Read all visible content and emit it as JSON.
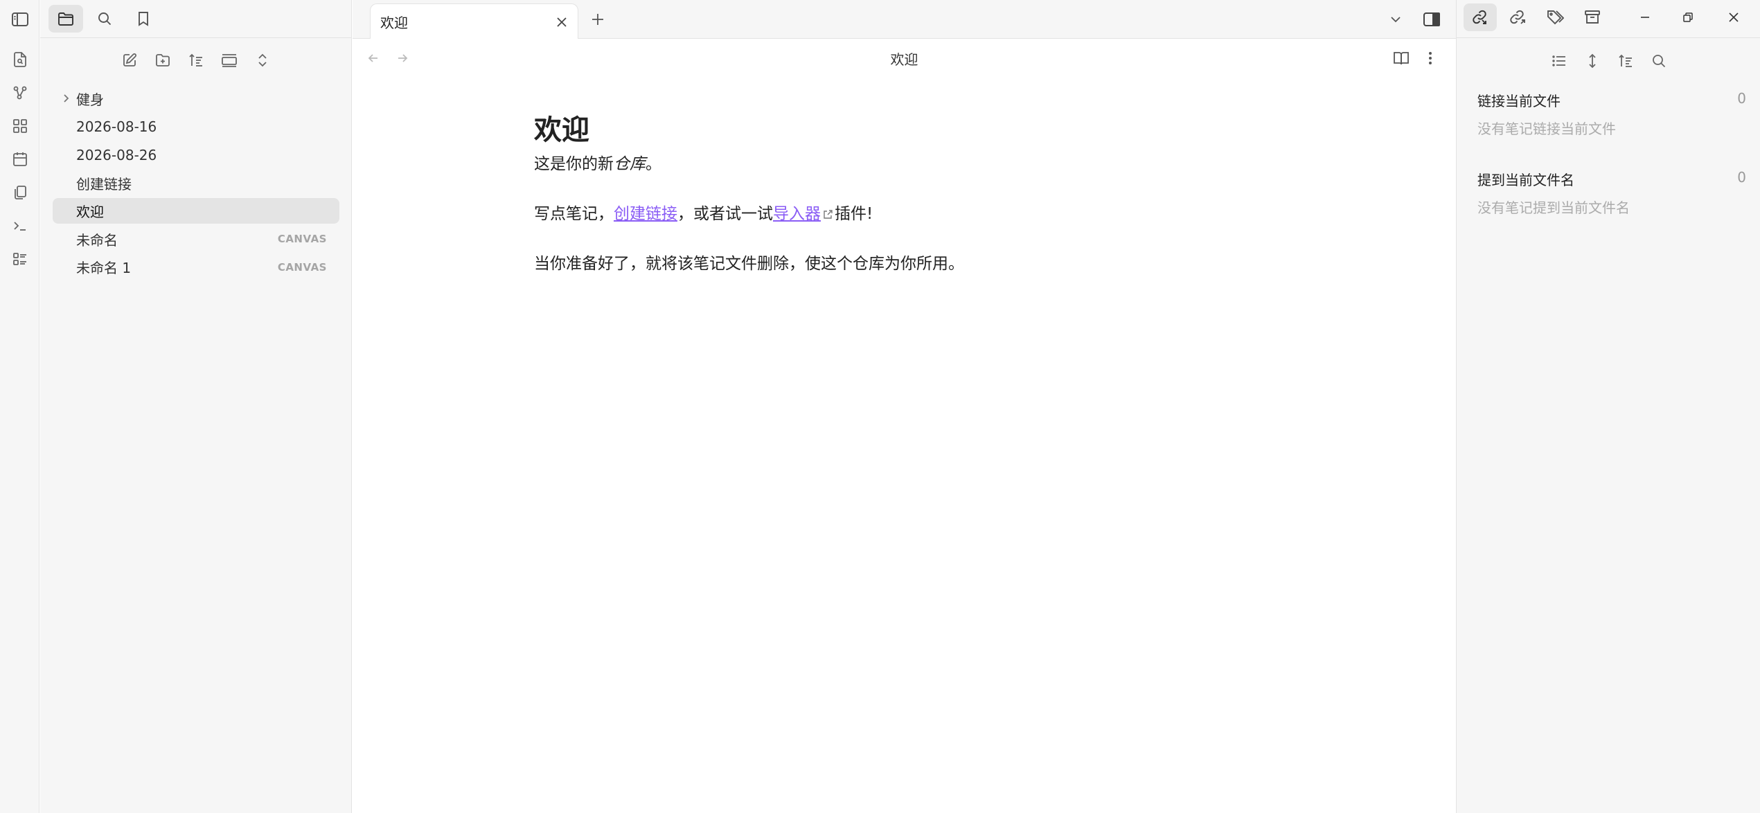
{
  "ribbon": {
    "top_icon": "sidebar-left-toggle-icon",
    "icons": [
      "quick-switcher-icon",
      "graph-view-icon",
      "canvas-icon",
      "daily-note-icon",
      "templates-icon",
      "command-palette-icon",
      "bases-icon"
    ]
  },
  "file_explorer": {
    "tabs": [
      "folder-icon",
      "search-icon",
      "bookmark-icon"
    ],
    "actions": [
      "new-note-icon",
      "new-folder-icon",
      "sort-icon",
      "collapse-all-icon",
      "expand-collapse-icon"
    ],
    "items": [
      {
        "label": "健身",
        "tag": "",
        "type": "folder"
      },
      {
        "label": "2026-08-16",
        "tag": "",
        "type": "file"
      },
      {
        "label": "2026-08-26",
        "tag": "",
        "type": "file"
      },
      {
        "label": "创建链接",
        "tag": "",
        "type": "file"
      },
      {
        "label": "欢迎",
        "tag": "",
        "type": "file"
      },
      {
        "label": "未命名",
        "tag": "CANVAS",
        "type": "file"
      },
      {
        "label": "未命名 1",
        "tag": "CANVAS",
        "type": "file"
      }
    ],
    "selected": "欢迎"
  },
  "tabs": {
    "active_label": "欢迎"
  },
  "view": {
    "title": "欢迎"
  },
  "document": {
    "heading": "欢迎",
    "p1_before": "这是你的新",
    "p1_em": "仓库",
    "p1_after": "。",
    "p2_before": "写点笔记，",
    "p2_link1": "创建链接",
    "p2_middle": "，或者试一试",
    "p2_link2": "导入器",
    "p2_after": "插件!",
    "p3": "当你准备好了，就将该笔记文件删除，使这个仓库为你所用。"
  },
  "right_panel": {
    "tabs": [
      "backlinks-icon",
      "outgoing-links-icon",
      "tags-icon",
      "archive-icon"
    ],
    "actions": [
      "list-icon",
      "expand-icon",
      "sort-icon",
      "search-icon"
    ],
    "backlinks": {
      "title": "链接当前文件",
      "count": "0",
      "empty": "没有笔记链接当前文件"
    },
    "mentions": {
      "title": "提到当前文件名",
      "count": "0",
      "empty": "没有笔记提到当前文件名"
    }
  },
  "colors": {
    "link": "#8a5cf5",
    "pane_bg": "#f6f6f6",
    "selected_bg": "#e4e4e4"
  }
}
